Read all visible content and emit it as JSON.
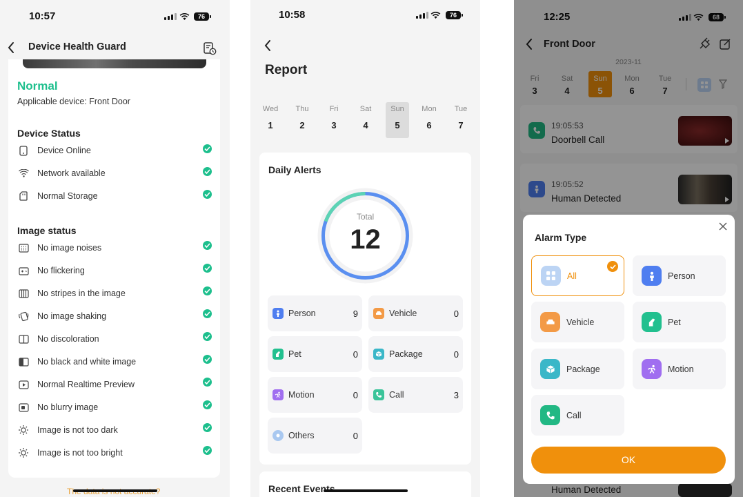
{
  "phone1": {
    "status": {
      "time": "10:57",
      "battery": "76"
    },
    "title": "Device Health Guard",
    "health_state": "Normal",
    "applicable_device": "Applicable device: Front Door",
    "device_status_heading": "Device Status",
    "device_status_items": [
      "Device Online",
      "Network available",
      "Normal Storage"
    ],
    "image_status_heading": "Image status",
    "image_status_items": [
      "No image noises",
      "No flickering",
      "No stripes in the image",
      "No image shaking",
      "No discoloration",
      "No black and white image",
      "Normal Realtime Preview",
      "No blurry image",
      "Image is not too dark",
      "Image is not too bright"
    ],
    "footer_link": "The data is not accurate?",
    "colors": {
      "accent": "#1dbf8d",
      "link": "#e8a23a"
    },
    "icons": {
      "back": "chevron-left-icon",
      "history": "doc-history-icon",
      "check": "check-circle-icon"
    }
  },
  "phone2": {
    "status": {
      "time": "10:58",
      "battery": "76"
    },
    "title": "Report",
    "days": [
      {
        "d": "Wed",
        "n": "1"
      },
      {
        "d": "Thu",
        "n": "2"
      },
      {
        "d": "Fri",
        "n": "3"
      },
      {
        "d": "Sat",
        "n": "4"
      },
      {
        "d": "Sun",
        "n": "5"
      },
      {
        "d": "Mon",
        "n": "6"
      },
      {
        "d": "Tue",
        "n": "7"
      }
    ],
    "selected_day": "5",
    "daily_alerts_title": "Daily Alerts",
    "total_label": "Total",
    "total_value": "12",
    "categories": [
      {
        "label": "Person",
        "value": "9",
        "color": "#4f7ef0"
      },
      {
        "label": "Vehicle",
        "value": "0",
        "color": "#f39a46"
      },
      {
        "label": "Pet",
        "value": "0",
        "color": "#22c08f"
      },
      {
        "label": "Package",
        "value": "0",
        "color": "#3ab7c8"
      },
      {
        "label": "Motion",
        "value": "0",
        "color": "#a06ef0"
      },
      {
        "label": "Call",
        "value": "3",
        "color": "#3bc49a"
      },
      {
        "label": "Others",
        "value": "0",
        "color": "#a9c8f0"
      }
    ],
    "recent_events_title": "Recent Events",
    "colors": {
      "ring_outer": "#5a8ff0",
      "ring_inner": "#5cd3b4"
    }
  },
  "phone3": {
    "status": {
      "time": "12:25",
      "battery": "68"
    },
    "title": "Front Door",
    "month": "2023-11",
    "days": [
      {
        "d": "Fri",
        "n": "3"
      },
      {
        "d": "Sat",
        "n": "4"
      },
      {
        "d": "Sun",
        "n": "5"
      },
      {
        "d": "Mon",
        "n": "6"
      },
      {
        "d": "Tue",
        "n": "7"
      }
    ],
    "selected_day": "5",
    "events": [
      {
        "time": "19:05:53",
        "label": "Doorbell Call"
      },
      {
        "time": "19:05:52",
        "label": "Human Detected"
      }
    ],
    "bottom_event": "Human Detected",
    "sheet_title": "Alarm Type",
    "alarm_types": [
      {
        "label": "All",
        "color": "#bcd4f4",
        "selected": true
      },
      {
        "label": "Person",
        "color": "#4f7ef0"
      },
      {
        "label": "Vehicle",
        "color": "#f39a46"
      },
      {
        "label": "Pet",
        "color": "#22c08f"
      },
      {
        "label": "Package",
        "color": "#3ab7c8"
      },
      {
        "label": "Motion",
        "color": "#a06ef0"
      },
      {
        "label": "Call",
        "color": "#22b884"
      }
    ],
    "ok_label": "OK",
    "colors": {
      "accent": "#f0900c"
    }
  }
}
